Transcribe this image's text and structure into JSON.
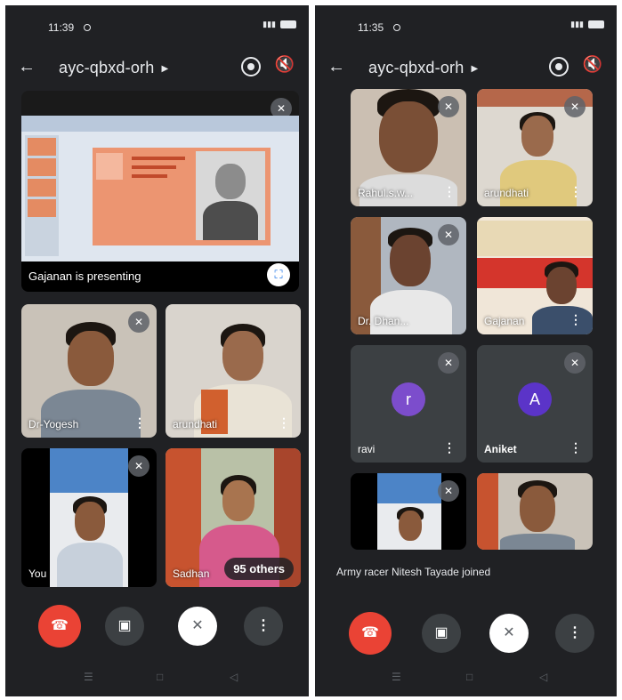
{
  "left": {
    "status_time": "11:39",
    "meeting_code": "ayc-qbxd-orh",
    "presenting_label": "Gajanan is presenting",
    "tiles": [
      {
        "name": "Dr-Yogesh"
      },
      {
        "name": "arundhati"
      },
      {
        "name": "You"
      },
      {
        "name": "Sadhan"
      }
    ],
    "others_count_label": "95 others"
  },
  "right": {
    "status_time": "11:35",
    "meeting_code": "ayc-qbxd-orh",
    "tiles": [
      {
        "name": "Rahul.s.w..."
      },
      {
        "name": "arundhati"
      },
      {
        "name": "Dr. Dhan..."
      },
      {
        "name": "Gajanan"
      },
      {
        "name": "ravi",
        "avatar_letter": "r"
      },
      {
        "name": "Aniket",
        "avatar_letter": "A"
      }
    ],
    "join_toast": "Army racer Nitesh Tayade joined"
  },
  "icons": {
    "back": "arrow-left-icon",
    "switch_camera": "switch-camera-icon",
    "speaker_off": "speaker-off-icon",
    "mic_off": "mic-off-icon",
    "end_call": "end-call-icon",
    "camera": "camera-icon",
    "more": "more-vertical-icon"
  },
  "colors": {
    "background": "#202124",
    "tile": "#3c4043",
    "end_call": "#ea4335",
    "avatar_ravi": "#7c4dcc",
    "avatar_aniket": "#5b34c8"
  }
}
